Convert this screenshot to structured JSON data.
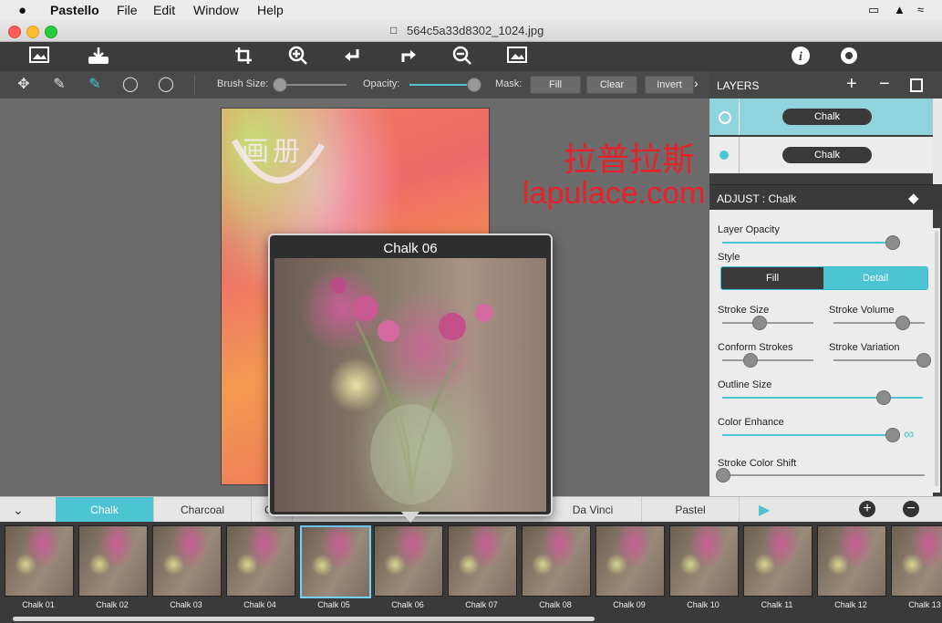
{
  "menubar": {
    "apple": "",
    "app": "Pastello",
    "items": [
      "File",
      "Edit",
      "Window",
      "Help"
    ]
  },
  "window": {
    "title": "564c5a33d8302_1024.jpg"
  },
  "toolbar_icons": [
    "open-image-icon",
    "save-icon",
    "crop-icon",
    "zoom-in-icon",
    "undo-icon",
    "redo-icon",
    "zoom-out-icon",
    "fit-image-icon",
    "info-icon",
    "settings-icon"
  ],
  "subbar": {
    "brush_label": "Brush Size:",
    "opacity_label": "Opacity:",
    "mask_label": "Mask:",
    "fill": "Fill",
    "clear": "Clear",
    "invert": "Invert",
    "brush_value": 0.03,
    "opacity_value": 1.0
  },
  "layers": {
    "title": "LAYERS",
    "items": [
      {
        "name": "Chalk",
        "selected": true
      },
      {
        "name": "Chalk",
        "selected": false
      }
    ]
  },
  "adjust": {
    "title": "ADJUST : Chalk",
    "layer_opacity": "Layer Opacity",
    "style": "Style",
    "style_options": [
      "Fill",
      "Detail"
    ],
    "style_selected": "Detail",
    "stroke_size": "Stroke Size",
    "stroke_volume": "Stroke Volume",
    "conform_strokes": "Conform Strokes",
    "stroke_variation": "Stroke Variation",
    "outline_size": "Outline Size",
    "color_enhance": "Color Enhance",
    "stroke_color_shift": "Stroke Color Shift",
    "values": {
      "layer_opacity": 0.98,
      "stroke_size": 0.4,
      "stroke_volume": 0.75,
      "conform_strokes": 0.3,
      "stroke_variation": 0.98,
      "outline_size": 0.8,
      "color_enhance": 0.98,
      "stroke_color_shift": 0.0
    }
  },
  "preview": {
    "title": "Chalk 06"
  },
  "tabs": [
    "Chalk",
    "Charcoal",
    "Da Vinci",
    "Pastel"
  ],
  "tab_partial": "C",
  "thumbnails": [
    "Chalk 01",
    "Chalk 02",
    "Chalk 03",
    "Chalk 04",
    "Chalk 05",
    "Chalk 06",
    "Chalk 07",
    "Chalk 08",
    "Chalk 09",
    "Chalk 10",
    "Chalk 11",
    "Chalk 12",
    "Chalk 13"
  ],
  "selected_thumbnail": "Chalk 05",
  "watermark": {
    "line1": "拉普拉斯",
    "line2": "lapulace.com"
  },
  "artwork_text": "画册",
  "colors": {
    "accent": "#4cc4d2",
    "toolbar": "#3c3c3c",
    "watermark": "#e8202a"
  }
}
